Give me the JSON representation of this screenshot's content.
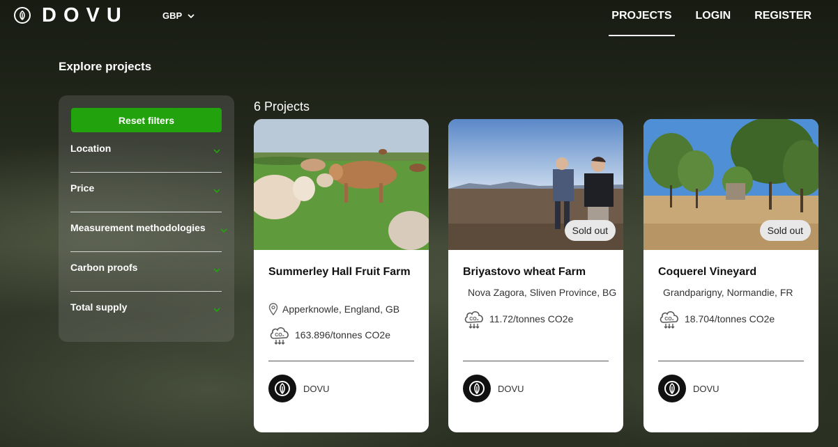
{
  "header": {
    "brand": "DOVU",
    "currency": "GBP",
    "nav": [
      {
        "label": "PROJECTS",
        "active": true
      },
      {
        "label": "LOGIN",
        "active": false
      },
      {
        "label": "REGISTER",
        "active": false
      }
    ]
  },
  "page_title": "Explore projects",
  "filters": {
    "reset_label": "Reset filters",
    "items": [
      "Location",
      "Price",
      "Measurement methodologies",
      "Carbon proofs",
      "Total supply"
    ],
    "accent_color": "#22a30e"
  },
  "projects_count": "6 Projects",
  "projects": [
    {
      "title": "Summerley Hall Fruit Farm",
      "location": "Apperknowle, England, GB",
      "co2": "163.896/tonnes CO2e",
      "owner": "DOVU",
      "sold_out": false,
      "sold_label": ""
    },
    {
      "title": "Briyastovo wheat Farm",
      "location": "Nova Zagora, Sliven Province, BG",
      "co2": "11.72/tonnes CO2e",
      "owner": "DOVU",
      "sold_out": true,
      "sold_label": "Sold out"
    },
    {
      "title": "Coquerel Vineyard",
      "location": "Grandparigny, Normandie, FR",
      "co2": "18.704/tonnes CO2e",
      "owner": "DOVU",
      "sold_out": true,
      "sold_label": "Sold out"
    }
  ]
}
